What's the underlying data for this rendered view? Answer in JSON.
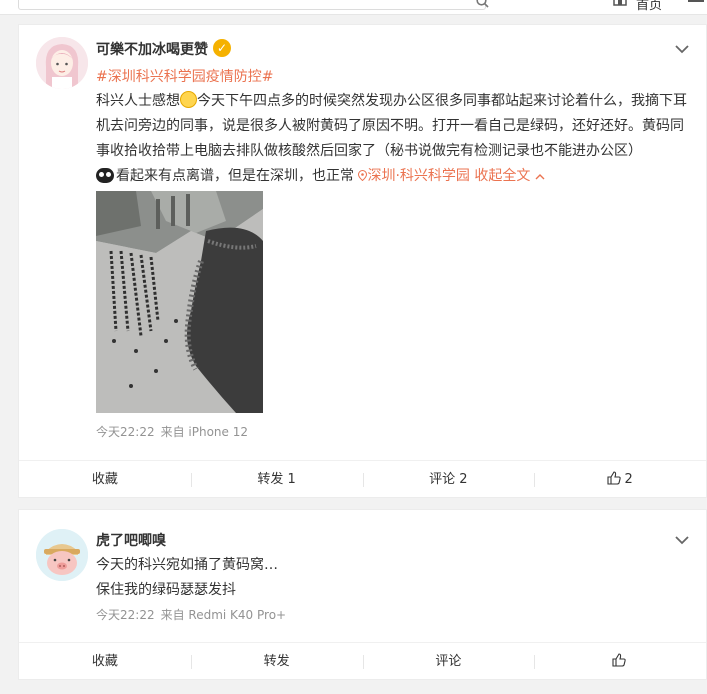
{
  "topbar": {
    "search_placeholder": "",
    "home_label": "首页"
  },
  "posts": [
    {
      "username": "可樂不加冰喝更赞",
      "verified": true,
      "topic": "#深圳科兴科学园疫情防控#",
      "content": {
        "line1_a": "科兴人士感想",
        "line1_b": "今天下午四点多的时候突然发现办公区很多同事都站起来讨论着什么，我摘下耳",
        "line2": "机去问旁边的同事，说是很多人被附黄码了原因不明。打开一看自己是绿码，还好还好。黄码同",
        "line3": "事收拾收拾带上电脑去排队做核酸然后回家了（秘书说做完有检测记录也不能进办公区）",
        "line4": "看起来有点离谱，但是在深圳，也正常",
        "location": "深圳·科兴科学园",
        "collapse": "收起全文"
      },
      "time": "今天22:22",
      "source": "来自 iPhone 12",
      "actions": {
        "favorite": "收藏",
        "repost": "转发 1",
        "comment": "评论 2",
        "like": "2"
      }
    },
    {
      "username": "虎了吧唧嗅",
      "verified": false,
      "content": {
        "line1": "今天的科兴宛如捅了黄码窝…",
        "line2": "保住我的绿码瑟瑟发抖"
      },
      "time": "今天22:22",
      "source": "来自 Redmi K40 Pro+",
      "actions": {
        "favorite": "收藏",
        "repost": "转发",
        "comment": "评论",
        "like": ""
      }
    }
  ],
  "colors": {
    "accent": "#eb7350",
    "meta": "#939393",
    "verified": "#f5b100",
    "background": "#f2f2f2"
  }
}
